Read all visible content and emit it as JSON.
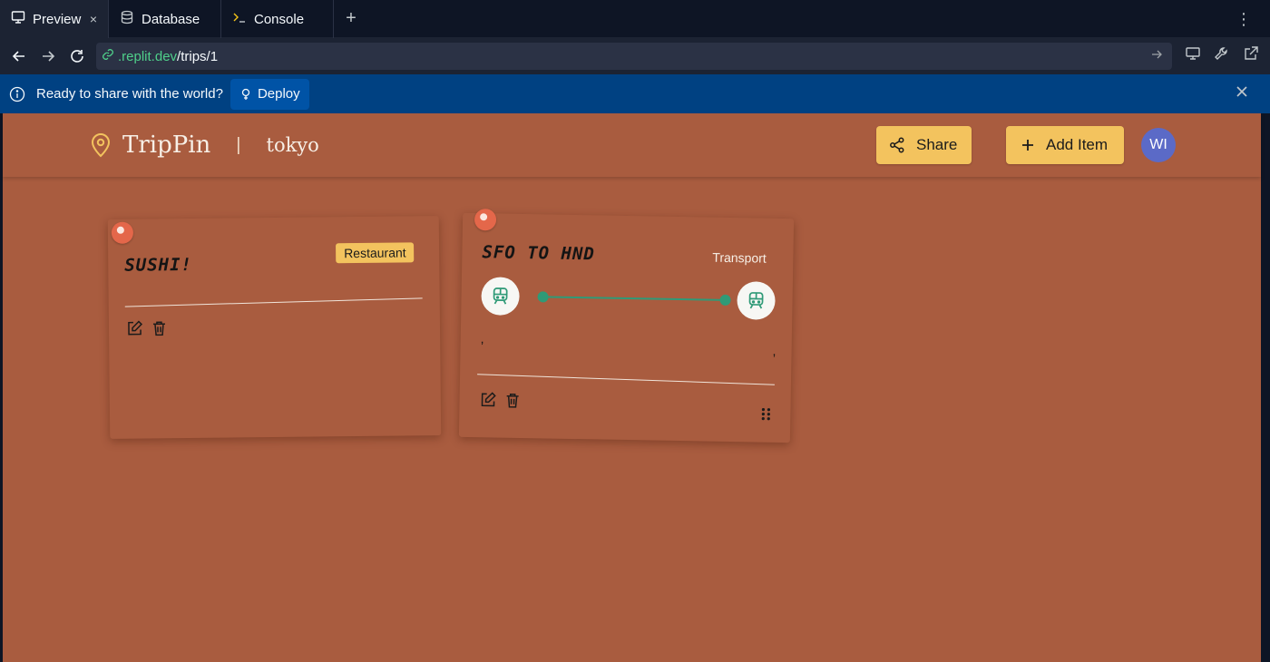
{
  "tabs": [
    {
      "label": "Preview",
      "icon": "monitor-icon",
      "active": true
    },
    {
      "label": "Database",
      "icon": "database-icon"
    },
    {
      "label": "Console",
      "icon": "console-icon"
    }
  ],
  "tab_close": "×",
  "tab_add": "+",
  "menu_glyph": "⋮",
  "address": {
    "domain": ".replit.dev",
    "path": "/trips/1"
  },
  "banner": {
    "text": "Ready to share with the world?",
    "deploy_label": "Deploy"
  },
  "app": {
    "brand": "TripPin",
    "separator": "|",
    "trip_name": "tokyo",
    "share_label": "Share",
    "add_label": "Add Item",
    "avatar": "WI"
  },
  "cards": [
    {
      "title": "SUSHI!",
      "tag": "Restaurant"
    },
    {
      "title": "SFO TO HND",
      "tag": "Transport",
      "from_detail": ",",
      "to_detail": ","
    }
  ],
  "colors": {
    "app_bg": "#a95c3f",
    "button": "#f3c35e",
    "route": "#2f9a77",
    "pin": "#e4674a",
    "banner": "#004182"
  }
}
